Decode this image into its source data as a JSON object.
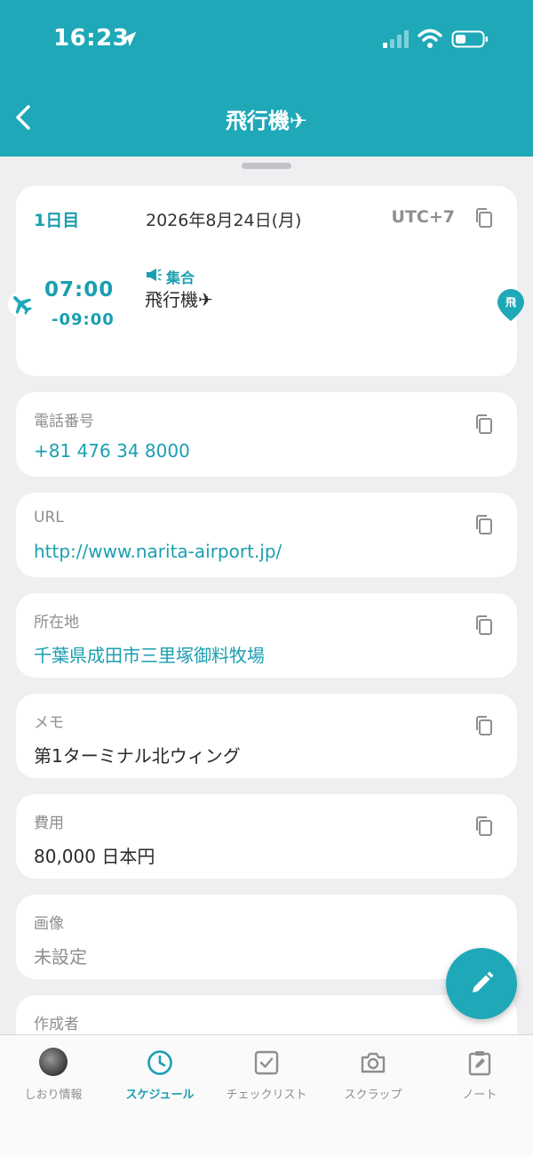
{
  "status_bar": {
    "time": "16:23"
  },
  "header": {
    "title": "飛行機✈"
  },
  "schedule": {
    "day": "1日目",
    "date": "2026年8月24日(月)",
    "timezone": "UTC+7",
    "start_time": "07:00",
    "end_time": "-09:00",
    "category": "集合",
    "event_title": "飛行機✈",
    "pin_label": "飛"
  },
  "fields": {
    "phone": {
      "label": "電話番号",
      "value": "+81 476 34 8000"
    },
    "url": {
      "label": "URL",
      "value": "http://www.narita-airport.jp/"
    },
    "address": {
      "label": "所在地",
      "value": "千葉県成田市三里塚御料牧場"
    },
    "memo": {
      "label": "メモ",
      "value": "第1ターミナル北ウィング"
    },
    "cost": {
      "label": "費用",
      "value": "80,000 日本円"
    },
    "image": {
      "label": "画像",
      "value": "未設定"
    },
    "author": {
      "label": "作成者"
    }
  },
  "tabs": [
    {
      "label": "しおり情報",
      "icon": "avatar"
    },
    {
      "label": "スケジュール",
      "icon": "clock-icon",
      "active": true
    },
    {
      "label": "チェックリスト",
      "icon": "checkbox-icon"
    },
    {
      "label": "スクラップ",
      "icon": "camera-icon"
    },
    {
      "label": "ノート",
      "icon": "note-icon"
    }
  ],
  "colors": {
    "accent": "#1ea8b8",
    "background": "#efeff1"
  }
}
